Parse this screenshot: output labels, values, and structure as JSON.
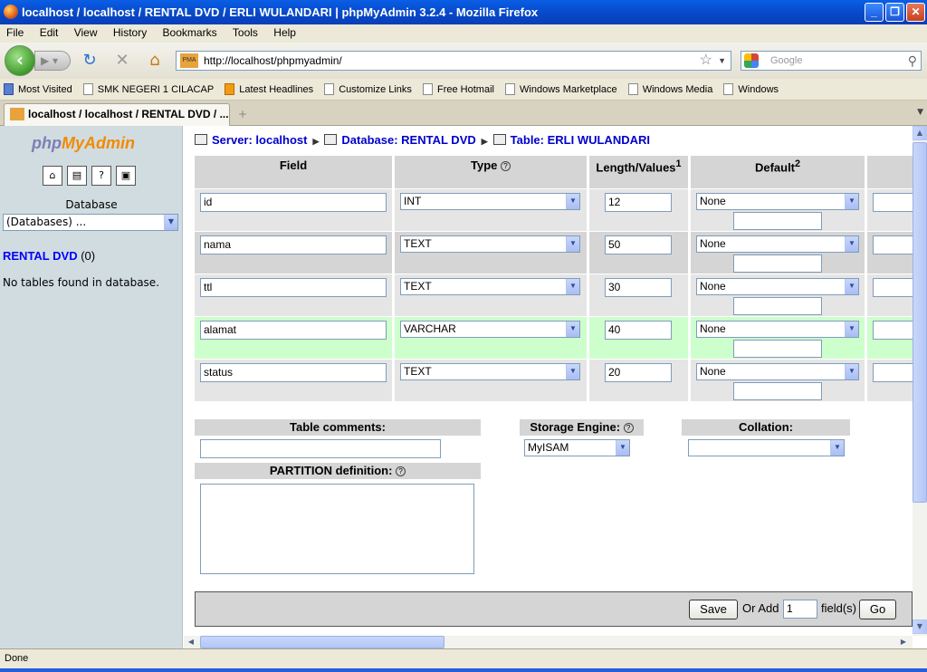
{
  "window": {
    "title": "localhost / localhost / RENTAL DVD / ERLI WULANDARI | phpMyAdmin 3.2.4 - Mozilla Firefox",
    "buttons": [
      "_",
      "❐",
      "✕"
    ]
  },
  "menu": [
    "File",
    "Edit",
    "View",
    "History",
    "Bookmarks",
    "Tools",
    "Help"
  ],
  "nav": {
    "url": "http://localhost/phpmyadmin/",
    "search_placeholder": "Google",
    "pma_badge": "PMA"
  },
  "bookmarks": [
    "Most Visited",
    "SMK NEGERI 1 CILACAP",
    "Latest Headlines",
    "Customize Links",
    "Free Hotmail",
    "Windows Marketplace",
    "Windows Media",
    "Windows"
  ],
  "tab": {
    "label": "localhost / localhost / RENTAL DVD / ..."
  },
  "sidebar": {
    "logo_php": "php",
    "logo_myadmin": "MyAdmin",
    "database_label": "Database",
    "database_select": "(Databases) ...",
    "db_name": "RENTAL DVD",
    "db_count": "(0)",
    "no_tables": "No tables found in database."
  },
  "breadcrumb": {
    "server": "Server: localhost",
    "database": "Database: RENTAL DVD",
    "table": "Table: ERLI WULANDARI"
  },
  "columns": {
    "field": "Field",
    "type": "Type",
    "length": "Length/Values",
    "length_sup": "1",
    "default": "Default",
    "default_sup": "2"
  },
  "rows": [
    {
      "field": "id",
      "type": "INT",
      "length": "12",
      "default": "None"
    },
    {
      "field": "nama",
      "type": "TEXT",
      "length": "50",
      "default": "None"
    },
    {
      "field": "ttl",
      "type": "TEXT",
      "length": "30",
      "default": "None"
    },
    {
      "field": "alamat",
      "type": "VARCHAR",
      "length": "40",
      "default": "None"
    },
    {
      "field": "status",
      "type": "TEXT",
      "length": "20",
      "default": "None"
    }
  ],
  "options": {
    "table_comments": "Table comments:",
    "storage_engine": "Storage Engine:",
    "storage_value": "MyISAM",
    "collation": "Collation:",
    "partition": "PARTITION definition:"
  },
  "footer": {
    "save": "Save",
    "or_add": "Or Add",
    "add_count": "1",
    "fields": "field(s)",
    "go": "Go"
  },
  "status": "Done"
}
